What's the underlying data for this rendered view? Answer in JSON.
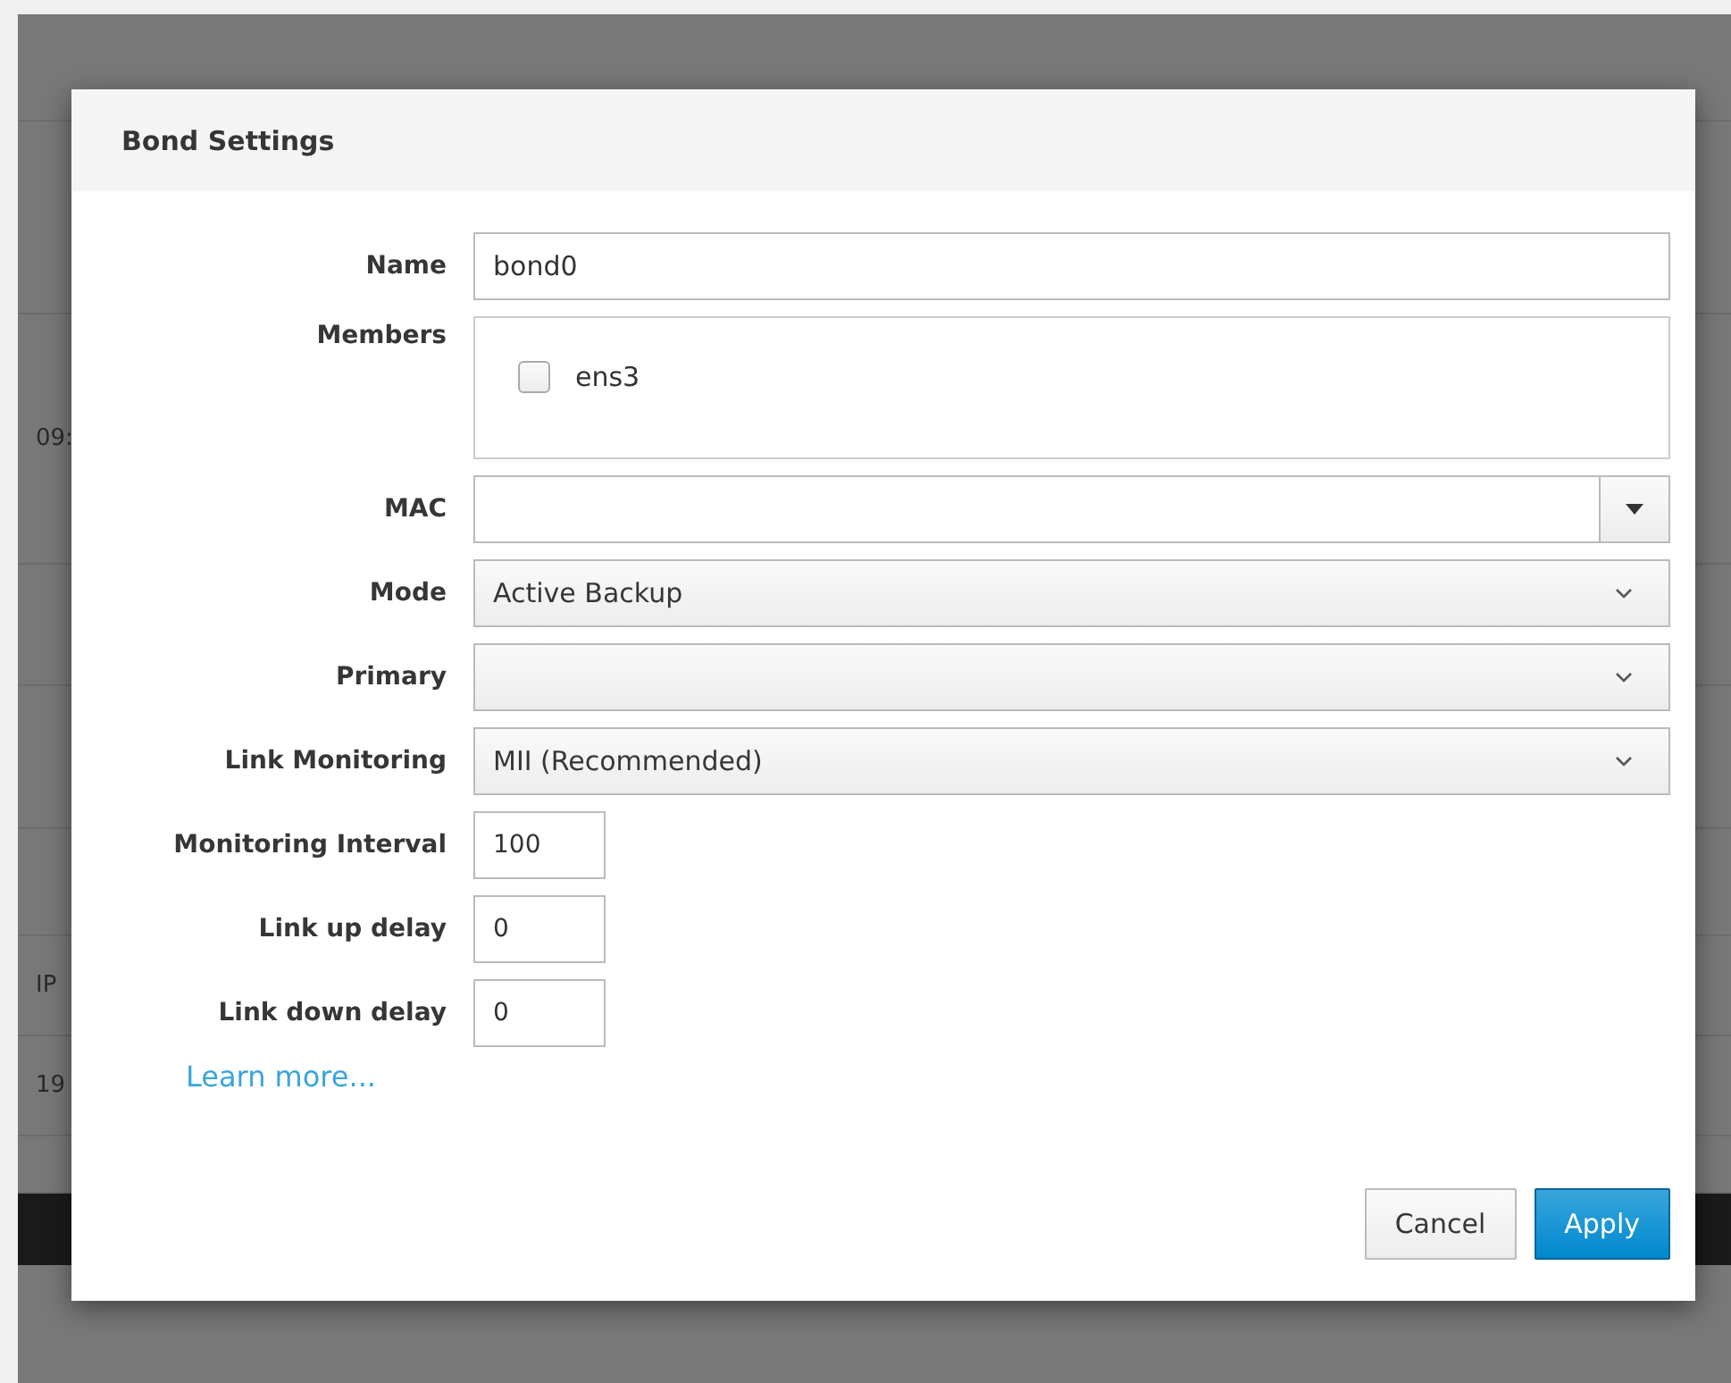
{
  "background": {
    "fragments": [
      "09:",
      "IP",
      "19"
    ]
  },
  "dialog": {
    "title": "Bond Settings",
    "fields": [
      {
        "kind": "text",
        "label": "Name",
        "value": "bond0"
      },
      {
        "kind": "members",
        "label": "Members",
        "members": [
          {
            "name": "ens3",
            "checked": false
          }
        ]
      },
      {
        "kind": "combo",
        "label": "MAC"
      },
      {
        "kind": "select",
        "label": "Mode",
        "value": "Active Backup"
      },
      {
        "kind": "select",
        "label": "Primary"
      },
      {
        "kind": "select",
        "label": "Link Monitoring",
        "value": "MII (Recommended)"
      },
      {
        "kind": "short",
        "label": "Monitoring Interval",
        "value": "100"
      },
      {
        "kind": "short",
        "label": "Link up delay",
        "value": "0"
      },
      {
        "kind": "short",
        "label": "Link down delay",
        "value": "0"
      }
    ],
    "link": "Learn more...",
    "buttons": [
      {
        "label": "Cancel",
        "kind": "default"
      },
      {
        "label": "Apply",
        "kind": "primary"
      }
    ]
  }
}
